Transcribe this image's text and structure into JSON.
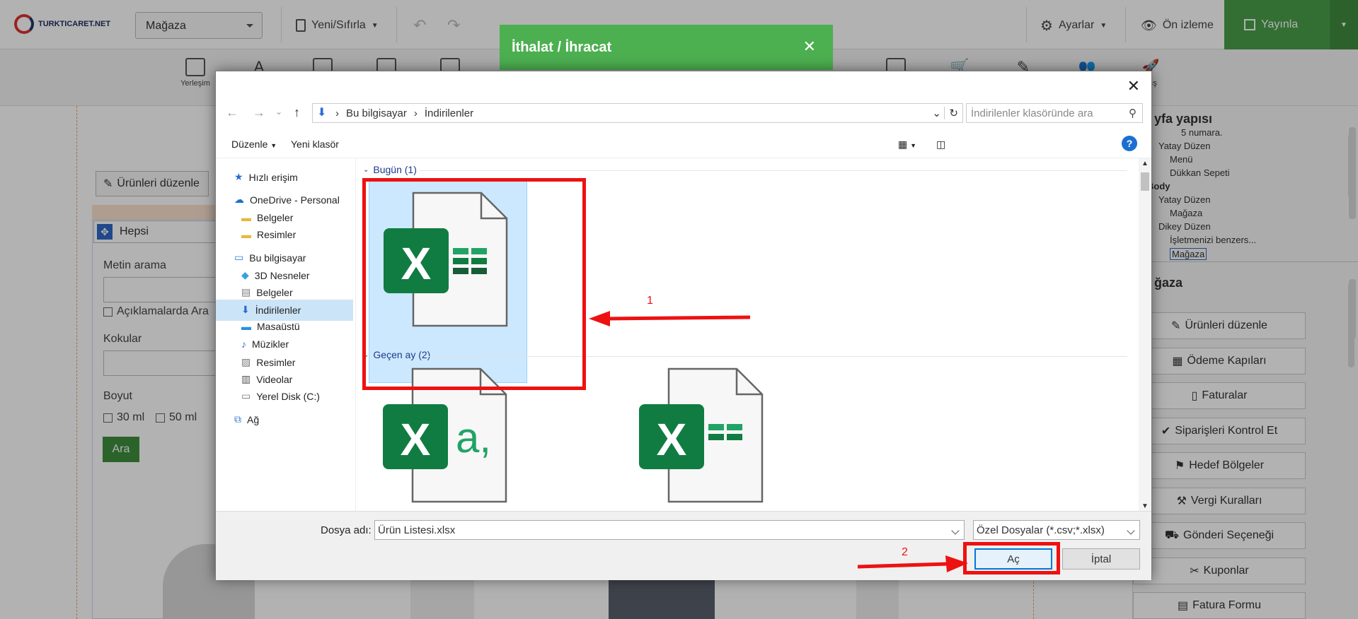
{
  "topbar": {
    "logo_text": "TURKTICARET.NET",
    "store_select": "Mağaza",
    "new_reset": "Yeni/Sıfırla",
    "settings": "Ayarlar",
    "preview": "Ön izleme",
    "publish": "Yayınla"
  },
  "toolbar": {
    "first_label": "Yerleşim",
    "last_label": "mış"
  },
  "canvas": {
    "edit_products": "Ürünleri düzenle",
    "filter_all": "Hepsi",
    "text_search": "Metin arama",
    "search_descriptions": "Açıklamalarda Ara",
    "scents": "Kokular",
    "size": "Boyut",
    "size_options": [
      "30 ml",
      "50 ml"
    ],
    "search_button": "Ara"
  },
  "right_panel": {
    "page_structure_title": "yfa yapısı",
    "tree": [
      {
        "label": "5 numara.",
        "indent": 3
      },
      {
        "label": "Yatay Düzen",
        "indent": 1
      },
      {
        "label": "Menü",
        "indent": 2
      },
      {
        "label": "Dükkan Sepeti",
        "indent": 2
      },
      {
        "label": "Body",
        "indent": 0,
        "bold": true
      },
      {
        "label": "Yatay Düzen",
        "indent": 1
      },
      {
        "label": "Mağaza",
        "indent": 2
      },
      {
        "label": "Dikey Düzen",
        "indent": 1
      },
      {
        "label": "İşletmenizi benzers...",
        "indent": 2
      },
      {
        "label": "Mağaza",
        "indent": 2,
        "selected": true
      }
    ],
    "section_title": "ğaza",
    "buttons": [
      "Ürünleri düzenle",
      "Ödeme Kapıları",
      "Faturalar",
      "Siparişleri Kontrol Et",
      "Hedef Bölgeler",
      "Vergi Kuralları",
      "Gönderi Seçeneği",
      "Kuponlar",
      "Fatura Formu"
    ]
  },
  "import_modal": {
    "title": "İthalat / İhracat"
  },
  "dialog": {
    "address": [
      "Bu bilgisayar",
      "İndirilenler"
    ],
    "search_placeholder": "İndirilenler klasöründe ara",
    "cmd_organize": "Düzenle",
    "cmd_new_folder": "Yeni klasör",
    "help": "?",
    "nav": [
      {
        "label": "Hızlı erişim",
        "icon": "star-icon",
        "indent": 0
      },
      {
        "label": "OneDrive - Personal",
        "icon": "cloud-icon",
        "indent": 0
      },
      {
        "label": "Belgeler",
        "icon": "folder-icon",
        "indent": 1
      },
      {
        "label": "Resimler",
        "icon": "folder-icon",
        "indent": 1
      },
      {
        "label": "Bu bilgisayar",
        "icon": "computer-icon",
        "indent": 0
      },
      {
        "label": "3D Nesneler",
        "icon": "cube-icon",
        "indent": 1
      },
      {
        "label": "Belgeler",
        "icon": "document-icon",
        "indent": 1
      },
      {
        "label": "İndirilenler",
        "icon": "download-icon",
        "indent": 1,
        "selected": true
      },
      {
        "label": "Masaüstü",
        "icon": "desktop-icon",
        "indent": 1
      },
      {
        "label": "Müzikler",
        "icon": "music-icon",
        "indent": 1
      },
      {
        "label": "Resimler",
        "icon": "picture-icon",
        "indent": 1
      },
      {
        "label": "Videolar",
        "icon": "video-icon",
        "indent": 1
      },
      {
        "label": "Yerel Disk (C:)",
        "icon": "disk-icon",
        "indent": 1
      },
      {
        "label": "Ağ",
        "icon": "network-icon",
        "indent": 0
      }
    ],
    "group_today": "Bugün (1)",
    "group_last_month": "Geçen ay (2)",
    "selected_file": "Ürün Listesi.xlsx",
    "filename_label": "Dosya adı:",
    "filename_value": "Ürün Listesi.xlsx",
    "filetype": "Özel Dosyalar (*.csv;*.xlsx)",
    "open_button": "Aç",
    "cancel_button": "İptal"
  },
  "annotations": {
    "step1": "1",
    "step2": "2"
  },
  "colors": {
    "excel_green": "#107c41",
    "publish_green": "#4a9f4a",
    "modal_green": "#4caf50",
    "annotation_red": "#e11111",
    "selection_blue": "#cce8ff"
  }
}
